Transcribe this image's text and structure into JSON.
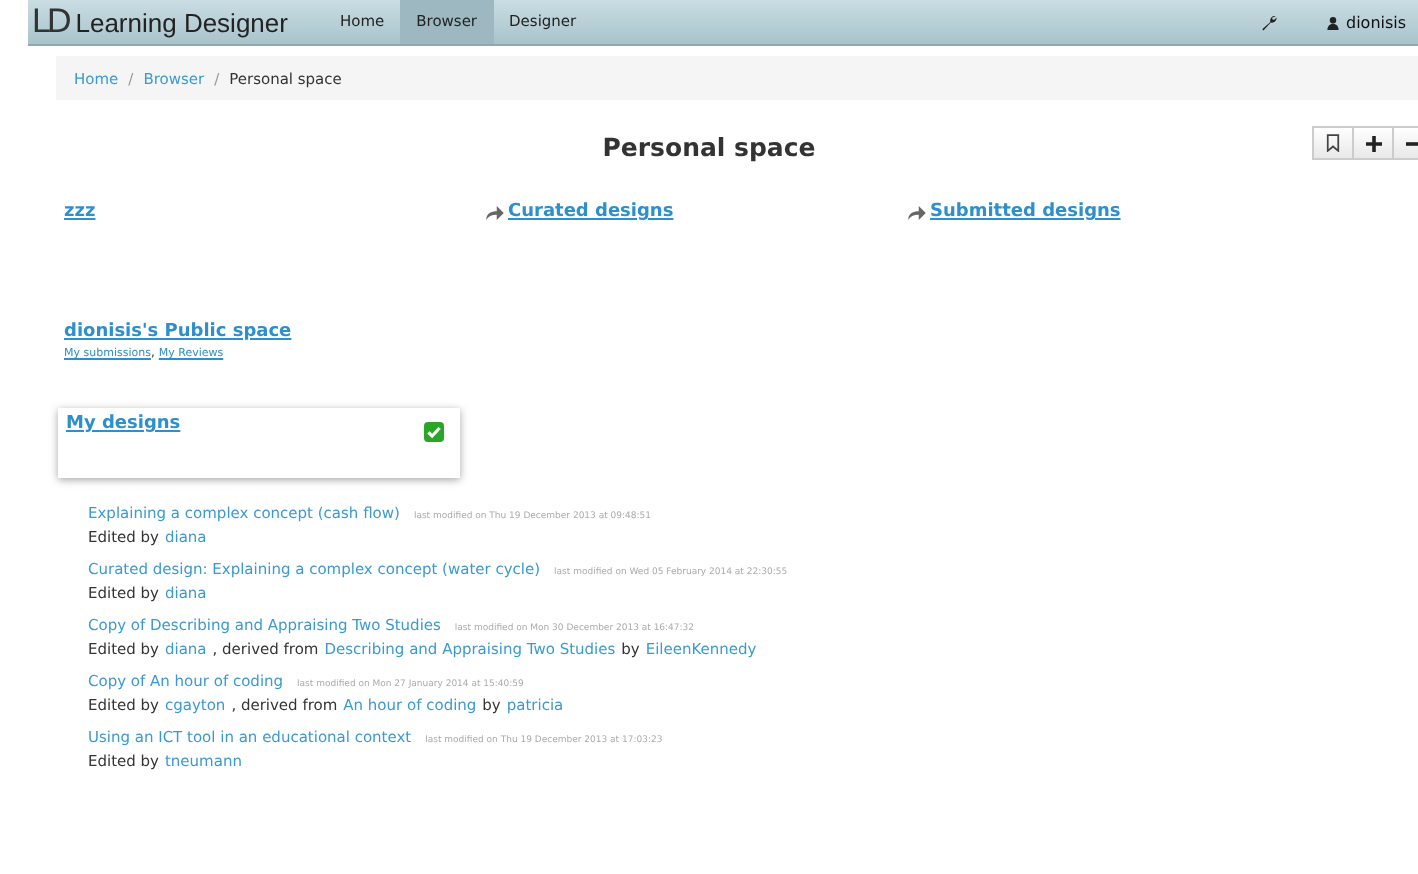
{
  "navbar": {
    "logo_mark": "LD",
    "brand": "Learning Designer",
    "tabs": [
      {
        "label": "Home",
        "selected": false
      },
      {
        "label": "Browser",
        "selected": true
      },
      {
        "label": "Designer",
        "selected": false
      }
    ],
    "user": "dionisis"
  },
  "breadcrumb": [
    {
      "label": "Home",
      "current": false
    },
    {
      "label": "Browser",
      "current": false
    },
    {
      "label": "Personal space",
      "current": true
    }
  ],
  "breadcrumb_separator": "/",
  "page_title": "Personal space",
  "spaces": [
    {
      "label": "zzz",
      "kind": "plain"
    },
    {
      "label": "Curated designs",
      "kind": "shared"
    },
    {
      "label": "Submitted designs",
      "kind": "shared"
    }
  ],
  "public_space": {
    "title": "dionisis's Public space",
    "links": [
      "My submissions",
      "My Reviews"
    ],
    "separator": ","
  },
  "my_designs": {
    "title": "My designs",
    "checked": true
  },
  "designs": [
    {
      "title": "Explaining a complex concept (cash flow)",
      "modified": "last modified on Thu 19 December 2013 at 09:48:51",
      "line": [
        {
          "text": "Edited by",
          "link": false
        },
        {
          "text": "diana",
          "link": true
        }
      ]
    },
    {
      "title": "Curated design: Explaining a complex concept (water cycle)",
      "modified": "last modified on Wed 05 February 2014 at 22:30:55",
      "line": [
        {
          "text": "Edited by",
          "link": false
        },
        {
          "text": "diana",
          "link": true
        }
      ]
    },
    {
      "title": "Copy of Describing and Appraising Two Studies",
      "modified": "last modified on Mon 30 December 2013 at 16:47:32",
      "line": [
        {
          "text": "Edited by",
          "link": false
        },
        {
          "text": "diana",
          "link": true
        },
        {
          "text": ", derived from",
          "link": false
        },
        {
          "text": "Describing and Appraising Two Studies",
          "link": true
        },
        {
          "text": "by",
          "link": false
        },
        {
          "text": "EileenKennedy",
          "link": true
        }
      ]
    },
    {
      "title": "Copy of An hour of coding",
      "modified": "last modified on Mon 27 January 2014 at 15:40:59",
      "line": [
        {
          "text": "Edited by",
          "link": false
        },
        {
          "text": "cgayton",
          "link": true
        },
        {
          "text": ", derived from",
          "link": false
        },
        {
          "text": "An hour of coding",
          "link": true
        },
        {
          "text": "by",
          "link": false
        },
        {
          "text": "patricia",
          "link": true
        }
      ]
    },
    {
      "title": "Using an ICT tool in an educational context",
      "modified": "last modified on Thu 19 December 2013 at 17:03:23",
      "line": [
        {
          "text": "Edited by",
          "link": false
        },
        {
          "text": "tneumann",
          "link": true
        }
      ]
    }
  ]
}
